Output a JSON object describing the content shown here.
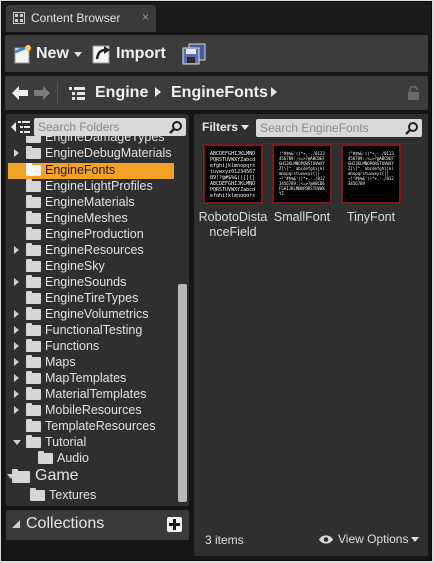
{
  "tab": {
    "title": "Content Browser",
    "close": "×"
  },
  "toolbar": {
    "new_label": "New",
    "import_label": "Import"
  },
  "nav": {
    "crumbs": [
      "Engine",
      "EngineFonts"
    ]
  },
  "folders": {
    "search_placeholder": "Search Folders",
    "items": [
      {
        "label": "EngineDamageTypes",
        "expandable": false
      },
      {
        "label": "EngineDebugMaterials",
        "expandable": true
      },
      {
        "label": "EngineFonts",
        "expandable": false,
        "selected": true
      },
      {
        "label": "EngineLightProfiles",
        "expandable": false
      },
      {
        "label": "EngineMaterials",
        "expandable": false
      },
      {
        "label": "EngineMeshes",
        "expandable": false
      },
      {
        "label": "EngineProduction",
        "expandable": false
      },
      {
        "label": "EngineResources",
        "expandable": true
      },
      {
        "label": "EngineSky",
        "expandable": false
      },
      {
        "label": "EngineSounds",
        "expandable": true
      },
      {
        "label": "EngineTireTypes",
        "expandable": false
      },
      {
        "label": "EngineVolumetrics",
        "expandable": true
      },
      {
        "label": "FunctionalTesting",
        "expandable": true
      },
      {
        "label": "Functions",
        "expandable": true
      },
      {
        "label": "Maps",
        "expandable": true
      },
      {
        "label": "MapTemplates",
        "expandable": true
      },
      {
        "label": "MaterialTemplates",
        "expandable": true
      },
      {
        "label": "MobileResources",
        "expandable": true
      },
      {
        "label": "TemplateResources",
        "expandable": false
      },
      {
        "label": "Tutorial",
        "expandable": true,
        "expanded": true
      },
      {
        "label": "Audio",
        "expandable": false,
        "child": true
      }
    ],
    "root_game": "Game",
    "game_child": "Textures"
  },
  "collections": {
    "label": "Collections"
  },
  "assets": {
    "filters_label": "Filters",
    "search_placeholder": "Search EngineFonts",
    "items": [
      {
        "name": "RobotoDistanceField"
      },
      {
        "name": "SmallFont"
      },
      {
        "name": "TinyFont"
      }
    ],
    "count_label": "3 items",
    "view_options_label": "View Options"
  },
  "colors": {
    "selection": "#f2a226",
    "thumb_border": "#7a1a1a"
  }
}
